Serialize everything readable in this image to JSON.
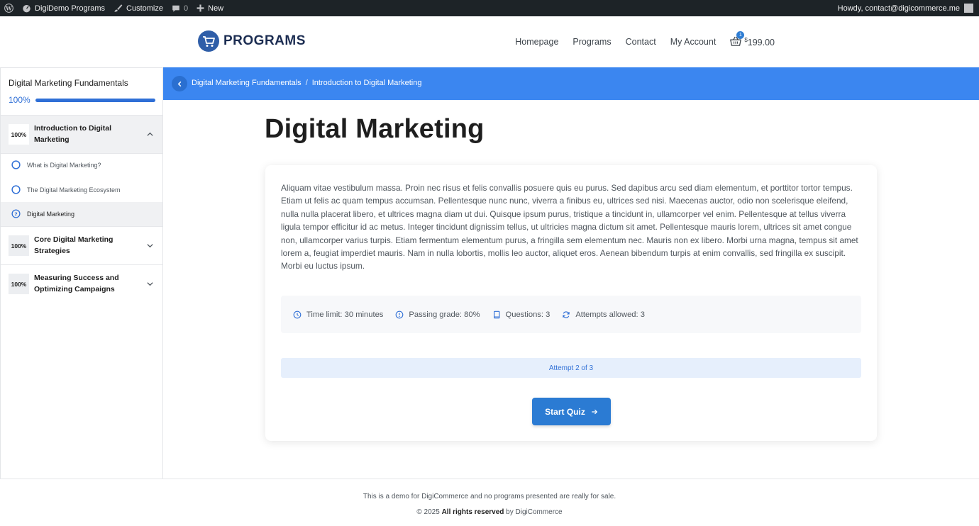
{
  "admin_bar": {
    "site_name": "DigiDemo Programs",
    "customize": "Customize",
    "comments_count": "0",
    "new": "New",
    "howdy": "Howdy, contact@digicommerce.me"
  },
  "header": {
    "logo_text": "PROGRAMS",
    "nav": [
      "Homepage",
      "Programs",
      "Contact",
      "My Account"
    ],
    "cart_count": "1",
    "cart_currency": "$",
    "cart_amount": "199.00"
  },
  "sidebar": {
    "course_title": "Digital Marketing Fundamentals",
    "progress_label": "100%",
    "progress": 1.0,
    "sections": [
      {
        "pct": "100%",
        "title": "Introduction to Digital Marketing",
        "expanded": true,
        "lessons": [
          {
            "label": "What is Digital Marketing?",
            "type": "lesson"
          },
          {
            "label": "The Digital Marketing Ecosystem",
            "type": "lesson"
          },
          {
            "label": "Digital Marketing",
            "type": "quiz",
            "current": true
          }
        ]
      },
      {
        "pct": "100%",
        "title": "Core Digital Marketing Strategies",
        "expanded": false
      },
      {
        "pct": "100%",
        "title": "Measuring Success and Optimizing Campaigns",
        "expanded": false
      }
    ]
  },
  "breadcrumb": {
    "items": [
      "Digital Marketing Fundamentals",
      "Introduction to Digital Marketing"
    ],
    "separator": "/"
  },
  "page": {
    "title": "Digital Marketing",
    "description": "Aliquam vitae vestibulum massa. Proin nec risus et felis convallis posuere quis eu purus. Sed dapibus arcu sed diam elementum, et porttitor tortor tempus. Etiam ut felis ac quam tempus accumsan. Pellentesque nunc nunc, viverra a finibus eu, ultrices sed nisi. Maecenas auctor, odio non scelerisque eleifend, nulla nulla placerat libero, et ultrices magna diam ut dui. Quisque ipsum purus, tristique a tincidunt in, ullamcorper vel enim. Pellentesque at tellus viverra ligula tempor efficitur id ac metus. Integer tincidunt dignissim tellus, ut ultricies magna dictum sit amet. Pellentesque mauris lorem, ultrices sit amet congue non, ullamcorper varius turpis. Etiam fermentum elementum purus, a fringilla sem elementum nec. Mauris non ex libero. Morbi urna magna, tempus sit amet lorem a, feugiat imperdiet mauris. Nam in nulla lobortis, mollis leo auctor, aliquet eros. Aenean bibendum turpis at enim convallis, sed fringilla ex suscipit. Morbi eu luctus ipsum.",
    "meta": [
      {
        "icon": "clock-icon",
        "text": "Time limit: 30 minutes"
      },
      {
        "icon": "info-circle-icon",
        "text": "Passing grade: 80%"
      },
      {
        "icon": "book-icon",
        "text": "Questions: 3"
      },
      {
        "icon": "refresh-icon",
        "text": "Attempts allowed: 3"
      }
    ],
    "attempt": "Attempt 2 of 3",
    "start_button": "Start Quiz"
  },
  "footer": {
    "disclaimer": "This is a demo for DigiCommerce and no programs presented are really for sale.",
    "copyright_prefix": "© 2025",
    "rights": "All rights reserved",
    "by": "by DigiCommerce"
  },
  "colors": {
    "accent": "#3b86f0",
    "button": "#2b7bd3",
    "admin_bar": "#1d2327",
    "progress": "#2f6fd6"
  }
}
